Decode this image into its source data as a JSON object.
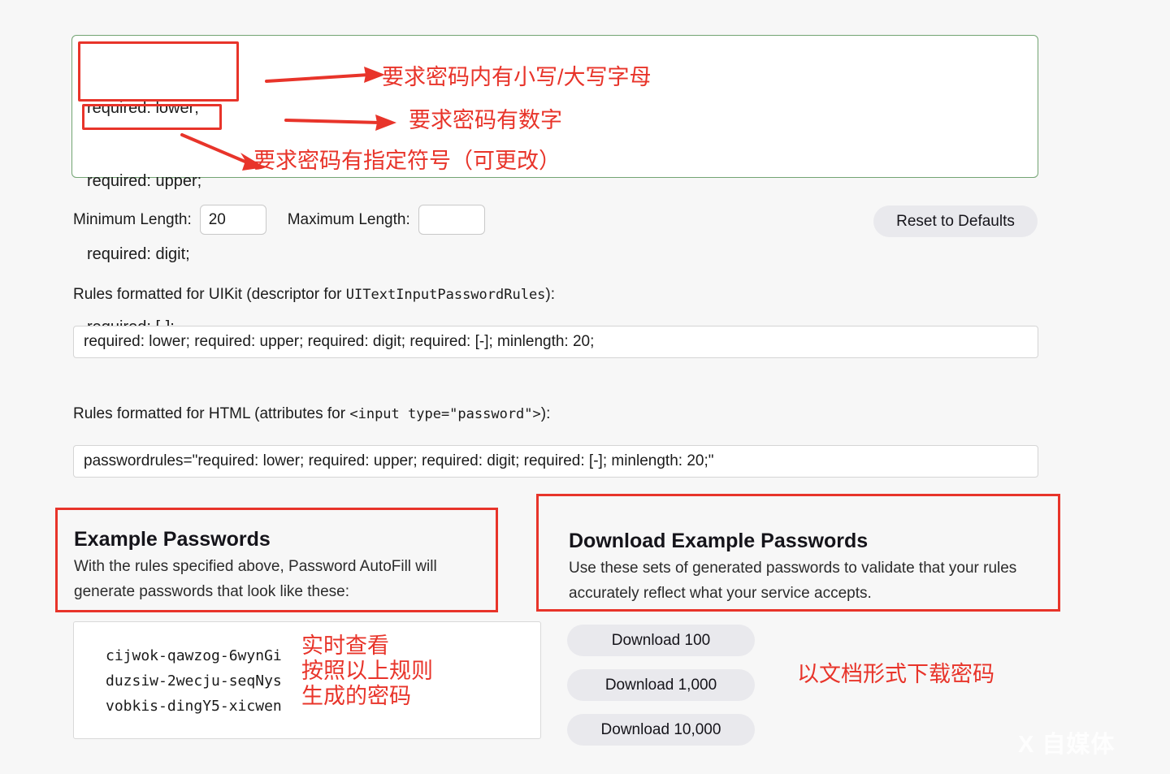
{
  "page": {
    "background_color": "#f7f7f7",
    "watermark": "X 自媒体"
  },
  "rules_editor": {
    "border_color": "#73a473",
    "lines": [
      "required: lower;",
      "required: upper;",
      "required: digit;",
      "required: [-];"
    ]
  },
  "annotations": {
    "color": "#e8342a",
    "lower_upper": "要求密码内有小写/大写字母",
    "digit": "要求密码有数字",
    "symbol": "要求密码有指定符号（可更改）",
    "live_preview": "实时查看\n按照以上规则\n生成的密码",
    "download_note": "以文档形式下载密码"
  },
  "length_row": {
    "minimum_label": "Minimum Length:",
    "minimum_value": "20",
    "maximum_label": "Maximum Length:",
    "maximum_value": "",
    "reset_label": "Reset to Defaults"
  },
  "uikit": {
    "label_prefix": "Rules formatted for UIKit (descriptor for ",
    "label_mono": "UITextInputPasswordRules",
    "label_suffix": "):",
    "value": "required: lower; required: upper; required: digit; required: [-]; minlength: 20;"
  },
  "html_rules": {
    "label_prefix": "Rules formatted for HTML (attributes for ",
    "label_mono": "<input type=\"password\">",
    "label_suffix": "):",
    "value": "passwordrules=\"required: lower; required: upper; required: digit; required: [-]; minlength: 20;\""
  },
  "example_section": {
    "title": "Example Passwords",
    "description": "With the rules specified above, Password AutoFill will generate passwords that look like these:",
    "passwords": [
      "cijwok-qawzog-6wynGi",
      "duzsiw-2wecju-seqNys",
      "vobkis-dingY5-xicwen"
    ]
  },
  "download_section": {
    "title": "Download Example Passwords",
    "description": "Use these sets of generated passwords to validate that your rules accurately reflect what your service accepts.",
    "buttons": [
      "Download 100",
      "Download 1,000",
      "Download 10,000"
    ]
  }
}
